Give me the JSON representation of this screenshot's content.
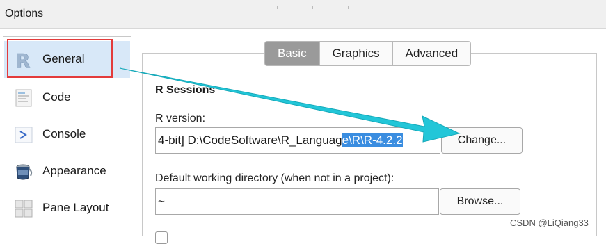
{
  "window": {
    "title": "Options"
  },
  "sidebar": {
    "items": [
      {
        "label": "General",
        "icon": "r-logo-icon"
      },
      {
        "label": "Code",
        "icon": "code-document-icon"
      },
      {
        "label": "Console",
        "icon": "console-prompt-icon"
      },
      {
        "label": "Appearance",
        "icon": "paint-bucket-icon"
      },
      {
        "label": "Pane Layout",
        "icon": "pane-layout-icon"
      }
    ],
    "selected": "General"
  },
  "tabs": [
    {
      "label": "Basic",
      "active": true
    },
    {
      "label": "Graphics",
      "active": false
    },
    {
      "label": "Advanced",
      "active": false
    }
  ],
  "r_sessions": {
    "heading": "R Sessions",
    "r_version_label": "R version:",
    "r_version_value_plain": "4-bit] D:\\CodeSoftware\\R_Languag",
    "r_version_value_selected": "e\\R\\R-4.2.2",
    "change_button": "Change...",
    "workdir_label": "Default working directory (when not in a project):",
    "workdir_value": "~",
    "browse_button": "Browse..."
  },
  "watermark": "CSDN @LiQiang33",
  "colors": {
    "selection_highlight": "#3a8de0",
    "annotation_box": "#e33b3b",
    "annotation_arrow": "#22c6d8",
    "active_tab": "#9a9a9a"
  }
}
